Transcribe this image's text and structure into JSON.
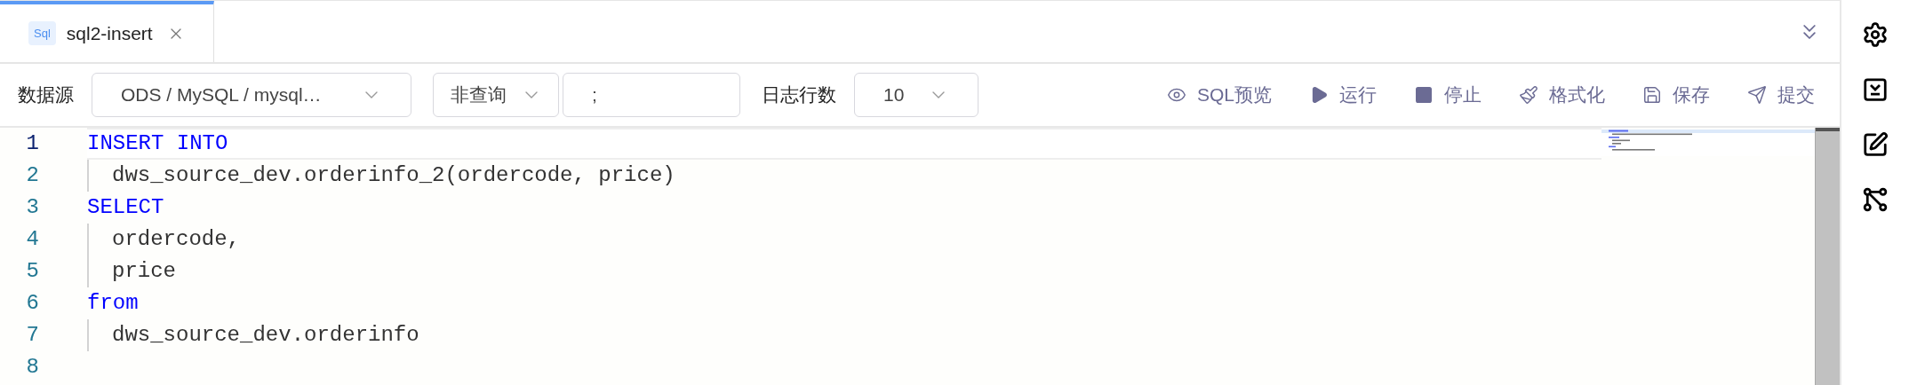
{
  "tabs": [
    {
      "badge": "Sql",
      "label": "sql2-insert",
      "selected": true
    }
  ],
  "toolbar": {
    "datasource_label": "数据源",
    "datasource": "ODS / MySQL / mysql…",
    "query_type": "非查询",
    "delimiter": ";",
    "log_rows_label": "日志行数",
    "log_rows": "10",
    "actions": [
      {
        "kind": "preview",
        "label": "SQL预览"
      },
      {
        "kind": "run",
        "label": "运行"
      },
      {
        "kind": "stop",
        "label": "停止"
      },
      {
        "kind": "format",
        "label": "格式化"
      },
      {
        "kind": "save",
        "label": "保存"
      },
      {
        "kind": "submit",
        "label": "提交"
      }
    ]
  },
  "editor": {
    "lines": [
      {
        "number": "1",
        "current": true,
        "indented": false,
        "tokens": [
          {
            "kind": "keyword",
            "text": "INSERT INTO"
          }
        ]
      },
      {
        "number": "2",
        "current": false,
        "indented": true,
        "tokens": [
          {
            "kind": "plain",
            "text": "dws_source_dev.orderinfo_2(ordercode, price)"
          }
        ]
      },
      {
        "number": "3",
        "current": false,
        "indented": false,
        "tokens": [
          {
            "kind": "keyword",
            "text": "SELECT"
          }
        ]
      },
      {
        "number": "4",
        "current": false,
        "indented": true,
        "tokens": [
          {
            "kind": "plain",
            "text": "ordercode,"
          }
        ]
      },
      {
        "number": "5",
        "current": false,
        "indented": true,
        "tokens": [
          {
            "kind": "plain",
            "text": "price"
          }
        ]
      },
      {
        "number": "6",
        "current": false,
        "indented": false,
        "tokens": [
          {
            "kind": "keyword",
            "text": "from"
          }
        ]
      },
      {
        "number": "7",
        "current": false,
        "indented": true,
        "tokens": [
          {
            "kind": "plain",
            "text": "dws_source_dev.orderinfo"
          }
        ]
      },
      {
        "number": "8",
        "current": false,
        "indented": false
      }
    ]
  },
  "sidebar": [
    {
      "kind": "settings"
    },
    {
      "kind": "download"
    },
    {
      "kind": "edit"
    },
    {
      "kind": "graph"
    }
  ]
}
